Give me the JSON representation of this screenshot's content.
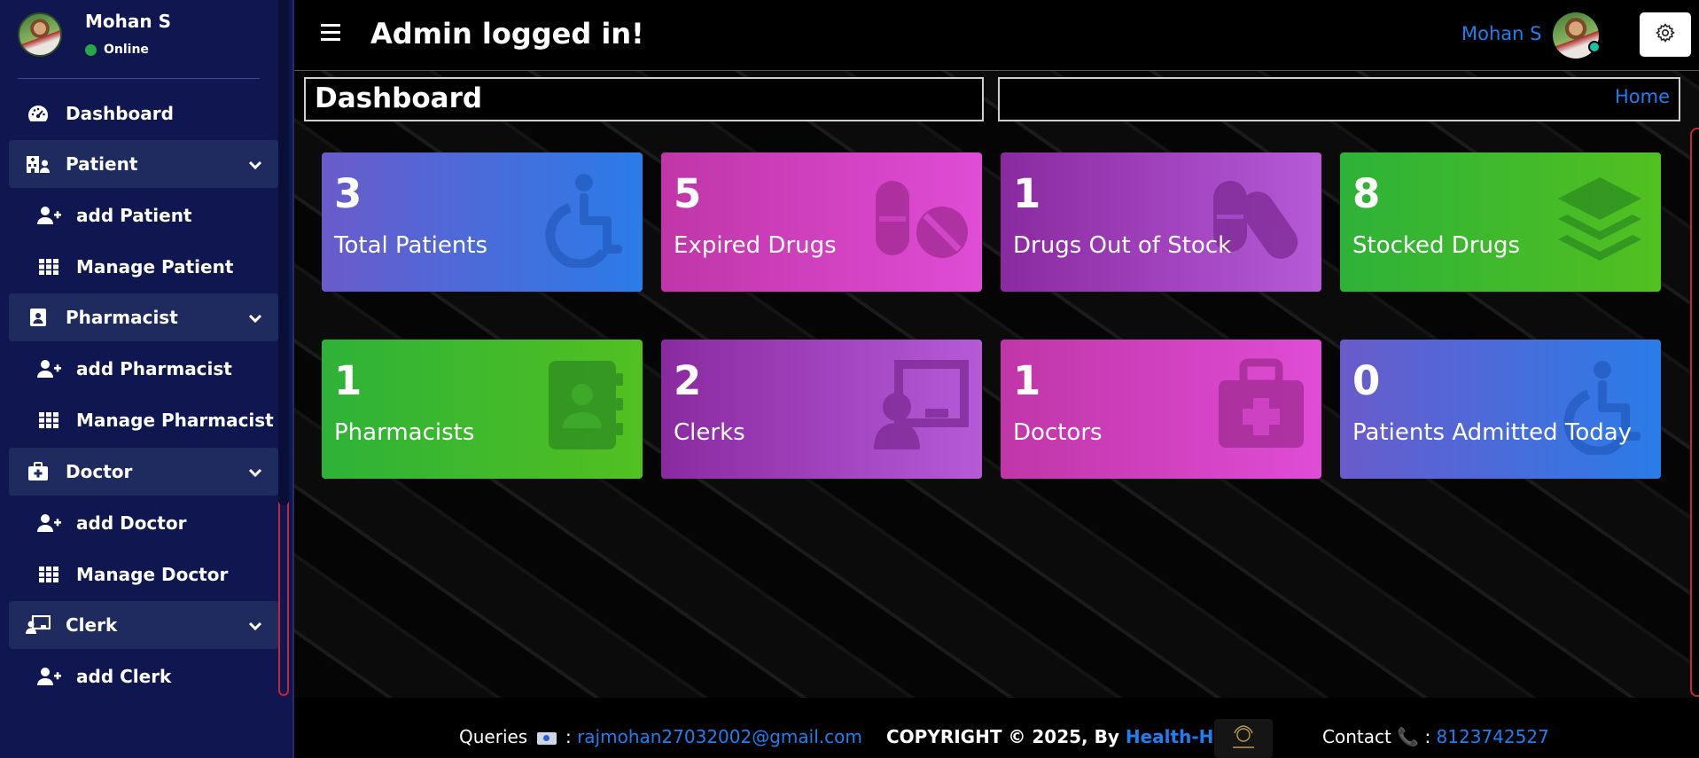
{
  "sidebar": {
    "user_name": "Mohan S",
    "status": "Online",
    "items": [
      {
        "label": "Dashboard",
        "icon": "dashboard-gauge-icon",
        "kind": "top"
      },
      {
        "label": "Patient",
        "icon": "hospital-user-icon",
        "kind": "group"
      },
      {
        "label": "add Patient",
        "icon": "user-plus-icon",
        "kind": "sub"
      },
      {
        "label": "Manage Patient",
        "icon": "grid-icon",
        "kind": "sub"
      },
      {
        "label": "Pharmacist",
        "icon": "id-badge-icon",
        "kind": "group"
      },
      {
        "label": "add Pharmacist",
        "icon": "user-plus-icon",
        "kind": "sub"
      },
      {
        "label": "Manage Pharmacist",
        "icon": "grid-icon",
        "kind": "sub"
      },
      {
        "label": "Doctor",
        "icon": "medkit-icon",
        "kind": "group"
      },
      {
        "label": "add Doctor",
        "icon": "user-plus-icon",
        "kind": "sub"
      },
      {
        "label": "Manage Doctor",
        "icon": "grid-icon",
        "kind": "sub"
      },
      {
        "label": "Clerk",
        "icon": "chalkboard-user-icon",
        "kind": "group"
      },
      {
        "label": "add Clerk",
        "icon": "user-plus-icon",
        "kind": "sub"
      }
    ]
  },
  "header": {
    "title": "Admin logged in!",
    "user_name": "Mohan S"
  },
  "page": {
    "title": "Dashboard",
    "breadcrumb": "Home"
  },
  "cards": [
    {
      "value": "3",
      "label": "Total Patients",
      "icon": "wheelchair-icon",
      "color": "#2a7ce8"
    },
    {
      "value": "5",
      "label": "Expired Drugs",
      "icon": "pills-icon",
      "color": "#e04cd6"
    },
    {
      "value": "1",
      "label": "Drugs Out of Stock",
      "icon": "capsules-icon",
      "color": "#b65ad8"
    },
    {
      "value": "8",
      "label": "Stocked Drugs",
      "icon": "layer-group-icon",
      "color": "#52c020"
    },
    {
      "value": "1",
      "label": "Pharmacists",
      "icon": "address-book-icon",
      "color": "#52c020"
    },
    {
      "value": "2",
      "label": "Clerks",
      "icon": "chalkboard-teacher-icon",
      "color": "#b65ad8"
    },
    {
      "value": "1",
      "label": "Doctors",
      "icon": "medkit-icon",
      "color": "#e04cd6"
    },
    {
      "value": "0",
      "label": "Patients Admitted Today",
      "icon": "wheelchair-icon",
      "color": "#2a7ce8"
    }
  ],
  "footer": {
    "queries_label": "Queries",
    "email": "rajmohan27032002@gmail.com",
    "copyright": "COPYRIGHT © 2025, By",
    "brand": "Health-Hub",
    "contact_label": "Contact",
    "phone": "8123742527"
  }
}
